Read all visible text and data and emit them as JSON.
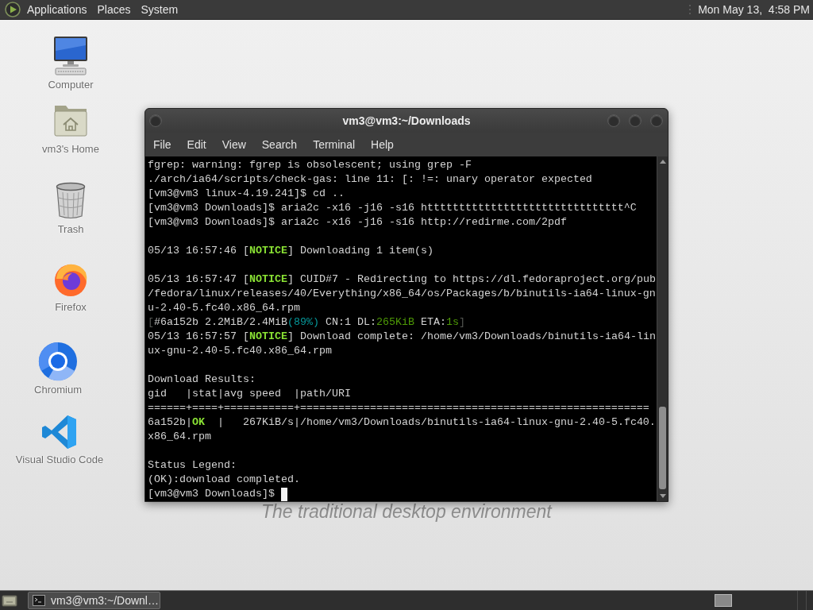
{
  "top_panel": {
    "menus": [
      {
        "label": "Applications"
      },
      {
        "label": "Places"
      },
      {
        "label": "System"
      }
    ],
    "clock": "Mon May 13,  4:58 PM"
  },
  "desktop": {
    "icons": [
      {
        "kind": "computer",
        "label": "Computer"
      },
      {
        "kind": "home",
        "label": "vm3's Home"
      },
      {
        "kind": "trash",
        "label": "Trash"
      },
      {
        "kind": "firefox",
        "label": "Firefox"
      },
      {
        "kind": "chromium",
        "label": "Chromium"
      },
      {
        "kind": "vscode",
        "label": "Visual Studio Code"
      }
    ],
    "wallpaper_text": "The traditional desktop environment"
  },
  "terminal_window": {
    "title": "vm3@vm3:~/Downloads",
    "menu": [
      {
        "label": "File"
      },
      {
        "label": "Edit"
      },
      {
        "label": "View"
      },
      {
        "label": "Search"
      },
      {
        "label": "Terminal"
      },
      {
        "label": "Help"
      }
    ],
    "blocks": [
      {
        "lines": [
          {
            "segments": [
              {
                "text": "fgrep: warning: fgrep is obsolescent; using grep -F"
              }
            ]
          },
          {
            "segments": [
              {
                "text": "./arch/ia64/scripts/check-gas: line 11: [: !=: unary operator expected"
              }
            ]
          },
          {
            "segments": [
              {
                "text": "[vm3@vm3 linux-4.19.241]$ cd .."
              }
            ]
          },
          {
            "segments": [
              {
                "text": "[vm3@vm3 Downloads]$ aria2c -x16 -j16 -s16 httttttttttttttttttttttttttttttt^C"
              }
            ]
          },
          {
            "segments": [
              {
                "text": "[vm3@vm3 Downloads]$ aria2c -x16 -j16 -s16 http://redirme.com/2pdf"
              }
            ]
          }
        ]
      },
      {
        "lines": [
          {
            "segments": [
              {
                "text": "05/13 16:57:46 ["
              },
              {
                "text": "NOTICE",
                "color": "#8ae234",
                "bold": true
              },
              {
                "text": "] Downloading 1 item(s)"
              }
            ]
          }
        ]
      },
      {
        "lines": [
          {
            "segments": [
              {
                "text": "05/13 16:57:47 ["
              },
              {
                "text": "NOTICE",
                "color": "#8ae234",
                "bold": true
              },
              {
                "text": "] CUID#7 - Redirecting to https://dl.fedoraproject.org/pub"
              }
            ]
          },
          {
            "segments": [
              {
                "text": "/fedora/linux/releases/40/Everything/x86_64/os/Packages/b/binutils-ia64-linux-gn"
              }
            ]
          },
          {
            "segments": [
              {
                "text": "u-2.40-5.fc40.x86_64.rpm"
              }
            ]
          },
          {
            "segments": [
              {
                "text": "[",
                "color": "#555753"
              },
              {
                "text": "#6a152b 2.2MiB/2.4MiB"
              },
              {
                "text": "(89%)",
                "color": "#06989a"
              },
              {
                "text": " CN:1 DL:"
              },
              {
                "text": "265KiB",
                "color": "#4e9a06"
              },
              {
                "text": " ETA:"
              },
              {
                "text": "1s",
                "color": "#4e9a06"
              },
              {
                "text": "]",
                "color": "#555753"
              }
            ]
          },
          {
            "segments": [
              {
                "text": "05/13 16:57:57 ["
              },
              {
                "text": "NOTICE",
                "color": "#8ae234",
                "bold": true
              },
              {
                "text": "] Download complete: /home/vm3/Downloads/binutils-ia64-lin"
              }
            ]
          },
          {
            "segments": [
              {
                "text": "ux-gnu-2.40-5.fc40.x86_64.rpm"
              }
            ]
          }
        ]
      },
      {
        "lines": [
          {
            "segments": [
              {
                "text": "Download Results:"
              }
            ]
          },
          {
            "segments": [
              {
                "text": "gid   |stat|avg speed  |path/URI"
              }
            ]
          },
          {
            "segments": [
              {
                "text": "======+====+===========+======================================================="
              }
            ]
          },
          {
            "segments": [
              {
                "text": "6a152b|"
              },
              {
                "text": "OK",
                "color": "#8ae234",
                "bold": true
              },
              {
                "text": "  |   267KiB/s|/home/vm3/Downloads/binutils-ia64-linux-gnu-2.40-5.fc40."
              }
            ]
          },
          {
            "segments": [
              {
                "text": "x86_64.rpm"
              }
            ]
          }
        ]
      },
      {
        "lines": [
          {
            "segments": [
              {
                "text": "Status Legend:"
              }
            ]
          },
          {
            "segments": [
              {
                "text": "(OK):download completed."
              }
            ]
          },
          {
            "segments": [
              {
                "text": "[vm3@vm3 Downloads]$ "
              }
            ]
          }
        ]
      }
    ],
    "cursor": true
  },
  "bottom_panel": {
    "tasks": [
      {
        "label": "vm3@vm3:~/Downl…",
        "selected": true
      }
    ]
  }
}
